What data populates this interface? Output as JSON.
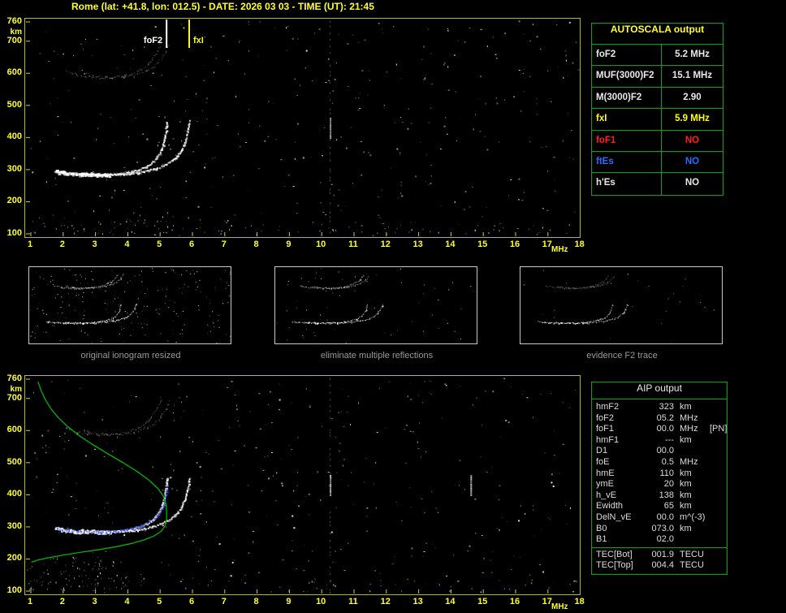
{
  "header": {
    "title": "Rome (lat: +41.8, lon: 012.5) - DATE: 2026 03 03 - TIME (UT): 21:45"
  },
  "autoscala": {
    "title": "AUTOSCALA output",
    "rows": [
      {
        "label": "foF2",
        "value": "5.2 MHz",
        "color": "#e8e8e8"
      },
      {
        "label": "MUF(3000)F2",
        "value": "15.1 MHz",
        "color": "#e8e8e8"
      },
      {
        "label": "M(3000)F2",
        "value": "2.90",
        "color": "#e8e8e8"
      },
      {
        "label": "fxI",
        "value": "5.9 MHz",
        "color": "#ffff00"
      },
      {
        "label": "foF1",
        "value": "NO",
        "color": "#ff2020"
      },
      {
        "label": "ftEs",
        "value": "NO",
        "color": "#2e6bff"
      },
      {
        "label": "h'Es",
        "value": "NO",
        "color": "#e8e8e8"
      }
    ]
  },
  "thumbnails": [
    {
      "caption": "original ionogram resized"
    },
    {
      "caption": "eliminate multiple reflections"
    },
    {
      "caption": "evidence F2 trace"
    }
  ],
  "aip": {
    "title": "AIP output",
    "rows": [
      {
        "label": "hmF2",
        "value": "323",
        "unit": "km",
        "note": ""
      },
      {
        "label": "foF2",
        "value": "05.2",
        "unit": "MHz",
        "note": ""
      },
      {
        "label": "foF1",
        "value": "00.0",
        "unit": "MHz",
        "note": "[PN]"
      },
      {
        "label": "hmF1",
        "value": "---",
        "unit": "km",
        "note": ""
      },
      {
        "label": "D1",
        "value": "00.0",
        "unit": "",
        "note": ""
      },
      {
        "label": "foE",
        "value": "0.5",
        "unit": "MHz",
        "note": ""
      },
      {
        "label": "hmE",
        "value": "110",
        "unit": "km",
        "note": ""
      },
      {
        "label": "ymE",
        "value": "20",
        "unit": "km",
        "note": ""
      },
      {
        "label": "h_vE",
        "value": "138",
        "unit": "km",
        "note": ""
      },
      {
        "label": "Ewidth",
        "value": "65",
        "unit": "km",
        "note": ""
      },
      {
        "label": "DelN_vE",
        "value": "00.0",
        "unit": "m^(-3)",
        "note": ""
      },
      {
        "label": "B0",
        "value": "073.0",
        "unit": "km",
        "note": ""
      },
      {
        "label": "B1",
        "value": "02.0",
        "unit": "",
        "note": ""
      }
    ],
    "tec_rows": [
      {
        "label": "TEC[Bot]",
        "value": "001.9",
        "unit": "TECU"
      },
      {
        "label": "TEC[Top]",
        "value": "004.4",
        "unit": "TECU"
      }
    ]
  },
  "chart_data": [
    {
      "type": "scatter",
      "title": "autoscaled ionogram",
      "xlabel": "MHz",
      "ylabel": "km",
      "xlim": [
        1,
        18
      ],
      "ylim": [
        100,
        760
      ],
      "x_ticks": [
        1,
        2,
        3,
        4,
        5,
        6,
        7,
        8,
        9,
        10,
        11,
        12,
        13,
        14,
        15,
        16,
        17,
        18
      ],
      "y_ticks": [
        760,
        700,
        600,
        500,
        400,
        300,
        200,
        100
      ],
      "markers": [
        {
          "name": "foF2",
          "mhz": 5.2,
          "color": "#ffffff",
          "label_side": "left"
        },
        {
          "name": "fxI",
          "mhz": 5.9,
          "color": "#ffff00",
          "label_side": "right"
        }
      ],
      "rfi_lines": [
        {
          "mhz": 10.25,
          "full_height": true
        }
      ],
      "series": [
        {
          "name": "F2-trace-ordinary",
          "color": "#ffffff",
          "points": [
            [
              1.75,
              298
            ],
            [
              2.0,
              293
            ],
            [
              2.3,
              289
            ],
            [
              2.6,
              287
            ],
            [
              2.9,
              286
            ],
            [
              3.2,
              286
            ],
            [
              3.5,
              287
            ],
            [
              3.8,
              290
            ],
            [
              4.1,
              295
            ],
            [
              4.35,
              302
            ],
            [
              4.55,
              311
            ],
            [
              4.72,
              322
            ],
            [
              4.86,
              336
            ],
            [
              4.97,
              352
            ],
            [
              5.05,
              370
            ],
            [
              5.11,
              390
            ],
            [
              5.15,
              412
            ],
            [
              5.18,
              434
            ],
            [
              5.2,
              456
            ]
          ]
        },
        {
          "name": "F2-trace-extraordinary",
          "color": "#ffffff",
          "points": [
            [
              2.55,
              291
            ],
            [
              2.85,
              288
            ],
            [
              3.15,
              286
            ],
            [
              3.45,
              286
            ],
            [
              3.75,
              287
            ],
            [
              4.05,
              289
            ],
            [
              4.35,
              293
            ],
            [
              4.6,
              298
            ],
            [
              4.85,
              305
            ],
            [
              5.08,
              314
            ],
            [
              5.28,
              325
            ],
            [
              5.45,
              338
            ],
            [
              5.58,
              353
            ],
            [
              5.68,
              370
            ],
            [
              5.76,
              390
            ],
            [
              5.82,
              412
            ],
            [
              5.87,
              436
            ],
            [
              5.9,
              458
            ]
          ]
        },
        {
          "name": "second-hop-ordinary",
          "color": "#c0c0c0",
          "points": [
            [
              2.1,
              607
            ],
            [
              2.4,
              597
            ],
            [
              2.7,
              591
            ],
            [
              3.0,
              588
            ],
            [
              3.3,
              587
            ],
            [
              3.6,
              589
            ],
            [
              3.9,
              594
            ],
            [
              4.15,
              602
            ],
            [
              4.38,
              613
            ],
            [
              4.58,
              627
            ],
            [
              4.74,
              644
            ],
            [
              4.87,
              664
            ],
            [
              4.97,
              686
            ],
            [
              5.04,
              710
            ]
          ]
        },
        {
          "name": "second-hop-extraordinary",
          "color": "#a8a8a8",
          "points": [
            [
              2.65,
              601
            ],
            [
              2.95,
              593
            ],
            [
              3.25,
              589
            ],
            [
              3.55,
              588
            ],
            [
              3.85,
              590
            ],
            [
              4.15,
              595
            ],
            [
              4.45,
              604
            ],
            [
              4.7,
              616
            ],
            [
              4.9,
              631
            ],
            [
              5.06,
              650
            ],
            [
              5.18,
              672
            ],
            [
              5.27,
              697
            ]
          ]
        }
      ]
    },
    {
      "type": "scatter",
      "title": "ionogram with restored F2 trace and electron density profile",
      "xlabel": "MHz",
      "ylabel": "km",
      "xlim": [
        1,
        18
      ],
      "ylim": [
        100,
        760
      ],
      "x_ticks": [
        1,
        2,
        3,
        4,
        5,
        6,
        7,
        8,
        9,
        10,
        11,
        12,
        13,
        14,
        15,
        16,
        17,
        18
      ],
      "y_ticks": [
        760,
        700,
        600,
        500,
        400,
        300,
        200,
        100
      ],
      "inherits_series_from": 0,
      "rfi_lines": [
        {
          "mhz": 10.25,
          "full_height": true
        },
        {
          "mhz": 14.6,
          "full_height": false
        }
      ],
      "series": [
        {
          "name": "restored-F2-trace",
          "color": "#3c5cff",
          "points": [
            [
              1.8,
              296
            ],
            [
              2.1,
              291
            ],
            [
              2.4,
              288
            ],
            [
              2.7,
              286
            ],
            [
              3.0,
              286
            ],
            [
              3.3,
              287
            ],
            [
              3.6,
              289
            ],
            [
              3.9,
              292
            ],
            [
              4.2,
              298
            ],
            [
              4.45,
              306
            ],
            [
              4.67,
              316
            ],
            [
              4.84,
              329
            ],
            [
              4.97,
              345
            ],
            [
              5.07,
              364
            ],
            [
              5.14,
              386
            ],
            [
              5.18,
              410
            ],
            [
              5.2,
              436
            ]
          ]
        },
        {
          "name": "electron-density-profile",
          "color": "#00c000",
          "style": "line",
          "points": [
            [
              1.22,
              752
            ],
            [
              1.32,
              724
            ],
            [
              1.45,
              696
            ],
            [
              1.62,
              668
            ],
            [
              1.85,
              640
            ],
            [
              2.14,
              612
            ],
            [
              2.5,
              584
            ],
            [
              2.92,
              556
            ],
            [
              3.38,
              528
            ],
            [
              3.85,
              500
            ],
            [
              4.28,
              473
            ],
            [
              4.65,
              446
            ],
            [
              4.93,
              420
            ],
            [
              5.1,
              396
            ],
            [
              5.18,
              372
            ],
            [
              5.2,
              348
            ],
            [
              5.2,
              323
            ],
            [
              5.16,
              304
            ],
            [
              5.04,
              287
            ],
            [
              4.82,
              272
            ],
            [
              4.5,
              259
            ],
            [
              4.1,
              248
            ],
            [
              3.62,
              238
            ],
            [
              3.1,
              229
            ],
            [
              2.55,
              221
            ],
            [
              2.0,
              212
            ],
            [
              1.55,
              204
            ],
            [
              1.22,
              197
            ],
            [
              1.02,
              190
            ]
          ]
        }
      ]
    }
  ]
}
